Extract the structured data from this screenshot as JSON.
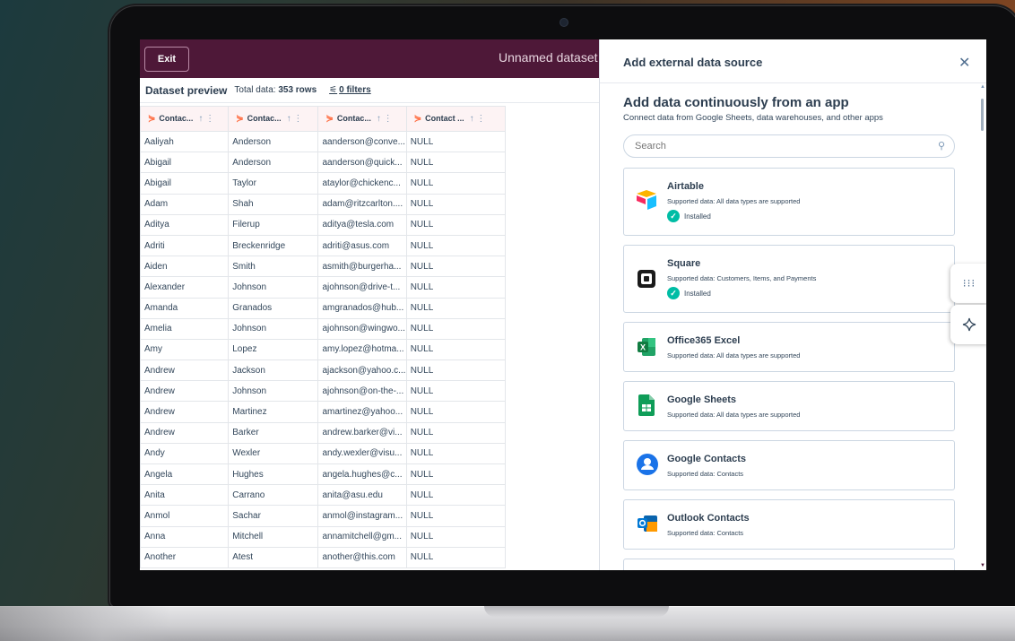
{
  "toolbar": {
    "exit_label": "Exit"
  },
  "dataset": {
    "title": "Unnamed dataset"
  },
  "preview": {
    "title": "Dataset preview",
    "total_label": "Total data:",
    "total_value": "353 rows",
    "filters_label": "0 filters"
  },
  "table": {
    "columns": [
      "Contac...",
      "Contac...",
      "Contac...",
      "Contact ..."
    ],
    "rows": [
      [
        "Aaliyah",
        "Anderson",
        "aanderson@conve...",
        "NULL"
      ],
      [
        "Abigail",
        "Anderson",
        "aanderson@quick...",
        "NULL"
      ],
      [
        "Abigail",
        "Taylor",
        "ataylor@chickenc...",
        "NULL"
      ],
      [
        "Adam",
        "Shah",
        "adam@ritzcarlton....",
        "NULL"
      ],
      [
        "Aditya",
        "Filerup",
        "aditya@tesla.com",
        "NULL"
      ],
      [
        "Adriti",
        "Breckenridge",
        "adriti@asus.com",
        "NULL"
      ],
      [
        "Aiden",
        "Smith",
        "asmith@burgerha...",
        "NULL"
      ],
      [
        "Alexander",
        "Johnson",
        "ajohnson@drive-t...",
        "NULL"
      ],
      [
        "Amanda",
        "Granados",
        "amgranados@hub...",
        "NULL"
      ],
      [
        "Amelia",
        "Johnson",
        "ajohnson@wingwo...",
        "NULL"
      ],
      [
        "Amy",
        "Lopez",
        "amy.lopez@hotma...",
        "NULL"
      ],
      [
        "Andrew",
        "Jackson",
        "ajackson@yahoo.c...",
        "NULL"
      ],
      [
        "Andrew",
        "Johnson",
        "ajohnson@on-the-...",
        "NULL"
      ],
      [
        "Andrew",
        "Martinez",
        "amartinez@yahoo...",
        "NULL"
      ],
      [
        "Andrew",
        "Barker",
        "andrew.barker@vi...",
        "NULL"
      ],
      [
        "Andy",
        "Wexler",
        "andy.wexler@visu...",
        "NULL"
      ],
      [
        "Angela",
        "Hughes",
        "angela.hughes@c...",
        "NULL"
      ],
      [
        "Anita",
        "Carrano",
        "anita@asu.edu",
        "NULL"
      ],
      [
        "Anmol",
        "Sachar",
        "anmol@instagram...",
        "NULL"
      ],
      [
        "Anna",
        "Mitchell",
        "annamitchell@gm...",
        "NULL"
      ],
      [
        "Another",
        "Atest",
        "another@this.com",
        "NULL"
      ]
    ]
  },
  "panel": {
    "title": "Add external data source",
    "section_heading": "Add data continuously from an app",
    "section_sub": "Connect data from Google Sheets, data warehouses, and other apps",
    "search_placeholder": "Search",
    "cards": [
      {
        "name": "Airtable",
        "support": "Supported data: All data types are supported",
        "installed": "Installed",
        "icon": "airtable-logo-icon"
      },
      {
        "name": "Square",
        "support": "Supported data: Customers, Items, and Payments",
        "installed": "Installed",
        "icon": "square-logo-icon"
      },
      {
        "name": "Office365 Excel",
        "support": "Supported data: All data types are supported",
        "icon": "excel-logo-icon"
      },
      {
        "name": "Google Sheets",
        "support": "Supported data: All data types are supported",
        "icon": "google-sheets-logo-icon"
      },
      {
        "name": "Google Contacts",
        "support": "Supported data: Contacts",
        "icon": "google-contacts-logo-icon"
      },
      {
        "name": "Outlook Contacts",
        "support": "Supported data: Contacts",
        "icon": "outlook-logo-icon"
      }
    ]
  },
  "colors": {
    "topbar": "#4e1838",
    "hubspot_orange": "#ff6a3d",
    "installed_green": "#00bda5",
    "text_dark": "#2d3e50"
  }
}
